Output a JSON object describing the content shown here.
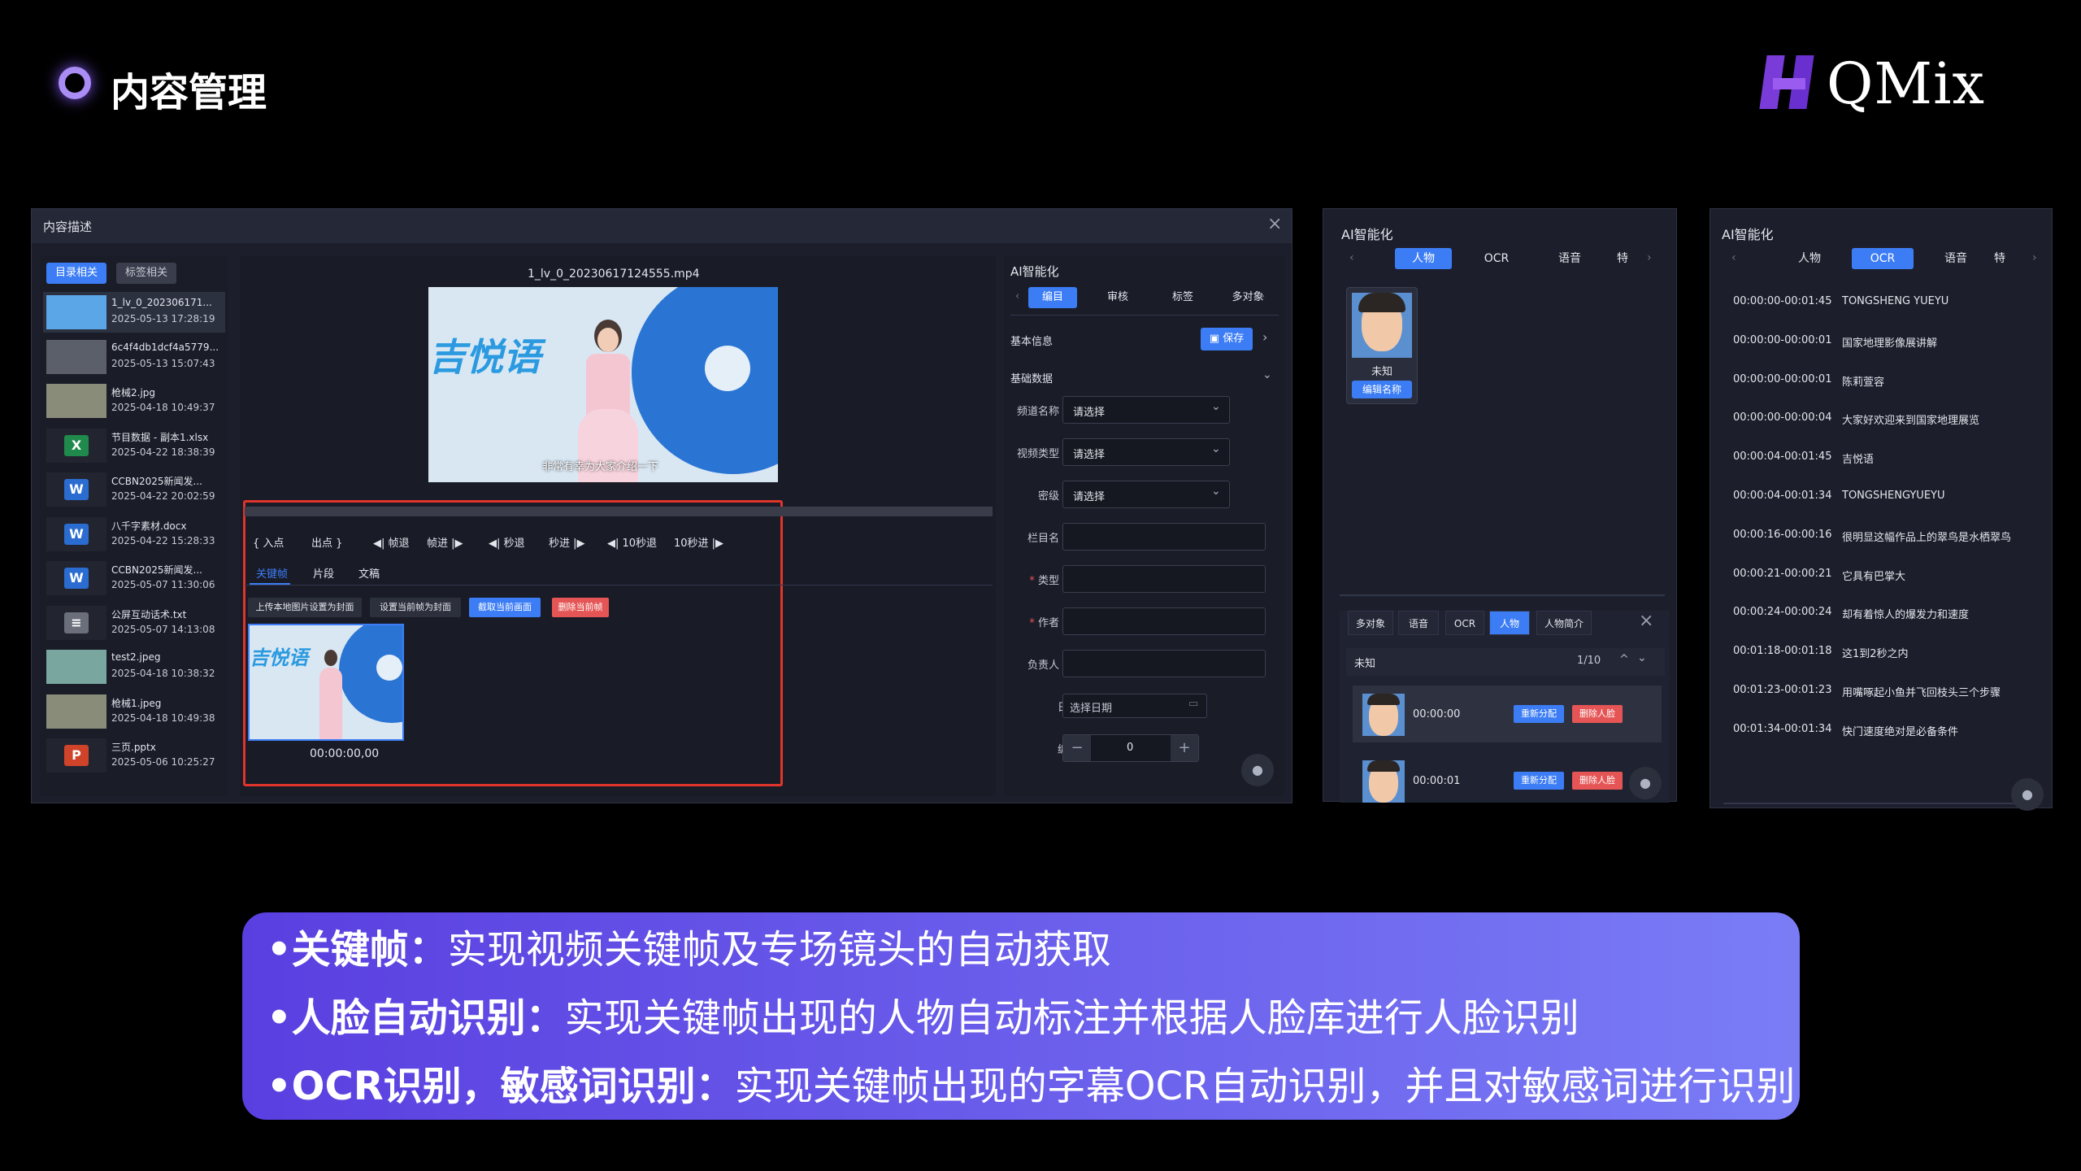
{
  "slide": {
    "title": "内容管理",
    "logo": "QMix",
    "bullets": [
      {
        "key": "•关键帧：",
        "text": "实现视频关键帧及专场镜头的自动获取"
      },
      {
        "key": "•人脸自动识别：",
        "text": "实现关键帧出现的人物自动标注并根据人脸库进行人脸识别"
      },
      {
        "key": "•OCR识别，敏感词识别：",
        "text": "实现关键帧出现的字幕OCR自动识别，并且对敏感词进行识别"
      }
    ],
    "colors": {
      "bullet_grad_start": "#5a3fe0",
      "bullet_grad_end": "#7a7cf6",
      "accent": "#3c7df5",
      "danger": "#e55555",
      "highlight": "#e0342c"
    }
  },
  "win1": {
    "title": "内容描述",
    "tabs": [
      "目录相关",
      "标签相关"
    ],
    "files": [
      {
        "name": "1_lv_0_202306171...",
        "date": "2025-05-13 17:28:19",
        "thumb": "video"
      },
      {
        "name": "6c4f4db1dcf4a5779...",
        "date": "2025-05-13 15:07:43",
        "thumb": "person"
      },
      {
        "name": "枪械2.jpg",
        "date": "2025-04-18 10:49:37",
        "thumb": "photo"
      },
      {
        "name": "节目数据 - 副本1.xlsx",
        "date": "2025-04-22 18:38:39",
        "thumb": "excel"
      },
      {
        "name": "CCBN2025新闻发...",
        "date": "2025-04-22 20:02:59",
        "thumb": "word"
      },
      {
        "name": "八千字素材.docx",
        "date": "2025-04-22 15:28:33",
        "thumb": "word"
      },
      {
        "name": "CCBN2025新闻发...",
        "date": "2025-05-07 11:30:06",
        "thumb": "word"
      },
      {
        "name": "公屏互动话术.txt",
        "date": "2025-05-07 14:13:08",
        "thumb": "txt"
      },
      {
        "name": "test2.jpeg",
        "date": "2025-04-18 10:38:32",
        "thumb": "landscape"
      },
      {
        "name": "枪械1.jpeg",
        "date": "2025-04-18 10:49:38",
        "thumb": "photo"
      },
      {
        "name": "三页.pptx",
        "date": "2025-05-06 10:25:27",
        "thumb": "ppt"
      }
    ],
    "video_filename": "1_lv_0_20230617124555.mp4",
    "video_caption": "非常有幸为大家介绍一下",
    "controls": [
      "{ 入点",
      "出点 }",
      "◀| 帧退",
      "帧进 |▶",
      "◀| 秒退",
      "秒进 |▶",
      "◀| 10秒退",
      "10秒进 |▶"
    ],
    "subtabs": [
      "关键帧",
      "片段",
      "文稿"
    ],
    "actions": [
      "上传本地图片设置为封面",
      "设置当前帧为封面",
      "截取当前画面",
      "删除当前帧"
    ],
    "keyframe_time": "00:00:00,00",
    "ai": {
      "title": "AI智能化",
      "tabs": [
        "编目",
        "审核",
        "标签",
        "多对象"
      ],
      "basic_info": "基本信息",
      "save": "保存",
      "basic_data": "基础数据",
      "fields": [
        {
          "label": "频道名称",
          "placeholder": "请选择"
        },
        {
          "label": "视频类型",
          "placeholder": "请选择"
        },
        {
          "label": "密级",
          "placeholder": "请选择"
        },
        {
          "label": "栏目名",
          "placeholder": ""
        },
        {
          "label": "* 类型",
          "placeholder": ""
        },
        {
          "label": "* 作者",
          "placeholder": ""
        },
        {
          "label": "负责人",
          "placeholder": ""
        }
      ],
      "date_label": "日期",
      "date_placeholder": "选择日期",
      "num_label": "编号",
      "num_value": "0"
    }
  },
  "win2": {
    "title": "AI智能化",
    "tabs": [
      "人物",
      "OCR",
      "语音",
      "特"
    ],
    "face_name": "未知",
    "edit_name": "编辑名称",
    "bottom_tabs": [
      "多对象",
      "语音",
      "OCR",
      "人物",
      "人物简介"
    ],
    "person": "未知",
    "page": "1/10",
    "entries": [
      {
        "time": "00:00:00",
        "reassign": "重新分配",
        "delete": "删除人脸"
      },
      {
        "time": "00:00:01",
        "reassign": "重新分配",
        "delete": "删除人脸"
      }
    ]
  },
  "win3": {
    "title": "AI智能化",
    "tabs": [
      "人物",
      "OCR",
      "语音",
      "特"
    ],
    "ocr": [
      {
        "time": "00:00:00-00:01:45",
        "text": "TONGSHENG YUEYU"
      },
      {
        "time": "00:00:00-00:00:01",
        "text": "国家地理影像展讲解"
      },
      {
        "time": "00:00:00-00:00:01",
        "text": "陈莉萱容"
      },
      {
        "time": "00:00:00-00:00:04",
        "text": "大家好欢迎来到国家地理展览"
      },
      {
        "time": "00:00:04-00:01:45",
        "text": "吉悦语"
      },
      {
        "time": "00:00:04-00:01:34",
        "text": "TONGSHENGYUEYU"
      },
      {
        "time": "00:00:16-00:00:16",
        "text": "很明显这幅作品上的翠鸟是水栖翠鸟"
      },
      {
        "time": "00:00:21-00:00:21",
        "text": "它具有巴掌大"
      },
      {
        "time": "00:00:24-00:00:24",
        "text": "却有着惊人的爆发力和速度"
      },
      {
        "time": "00:01:18-00:01:18",
        "text": "这1到2秒之内"
      },
      {
        "time": "00:01:23-00:01:23",
        "text": "用嘴啄起小鱼并飞回枝头三个步骤"
      },
      {
        "time": "00:01:34-00:01:34",
        "text": "快门速度绝对是必备条件"
      }
    ]
  }
}
